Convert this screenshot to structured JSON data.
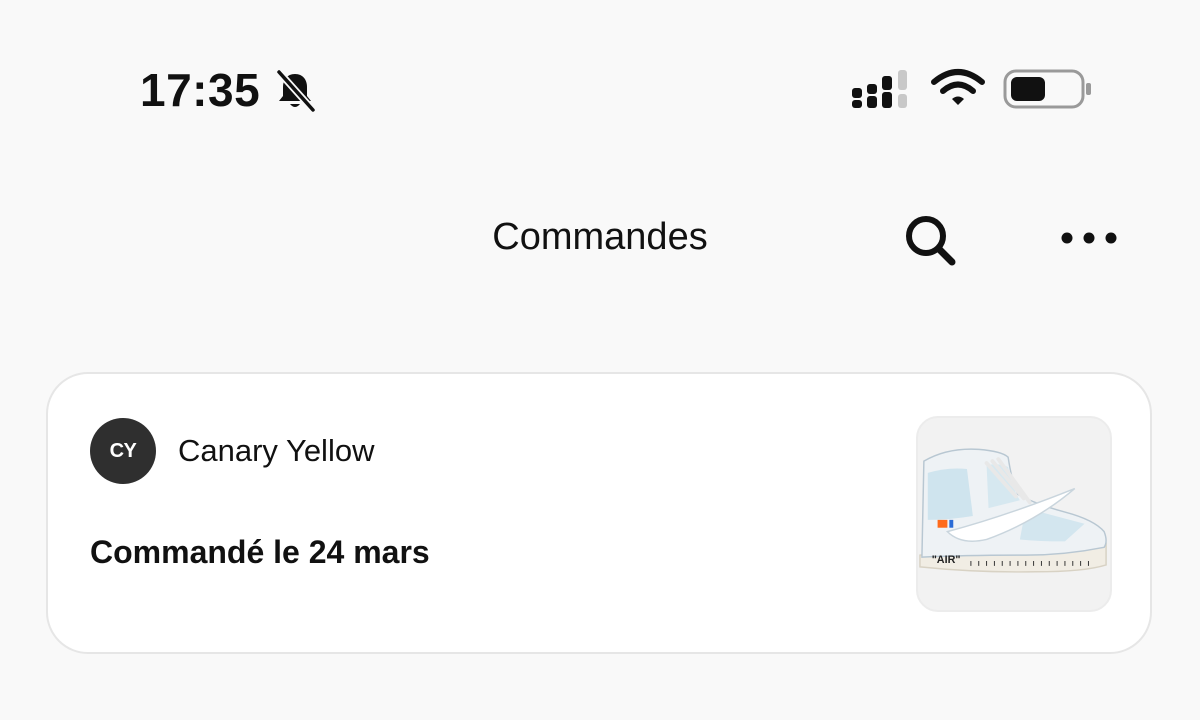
{
  "status_bar": {
    "time": "17:35",
    "icons": [
      "bell-slash-icon",
      "cellular-signal-icon",
      "wifi-icon",
      "battery-icon"
    ],
    "battery_level": 0.45
  },
  "header": {
    "title": "Commandes",
    "search_icon": "search-icon",
    "more_icon": "more-horizontal-icon"
  },
  "orders": [
    {
      "seller_initials": "CY",
      "seller_name": "Canary Yellow",
      "order_date": "Commandé le 24 mars",
      "product_image_text": "\"AIR\""
    }
  ],
  "colors": {
    "background": "#f9f9f9",
    "card": "#ffffff",
    "avatar": "#2f2f2f",
    "text": "#111111"
  }
}
